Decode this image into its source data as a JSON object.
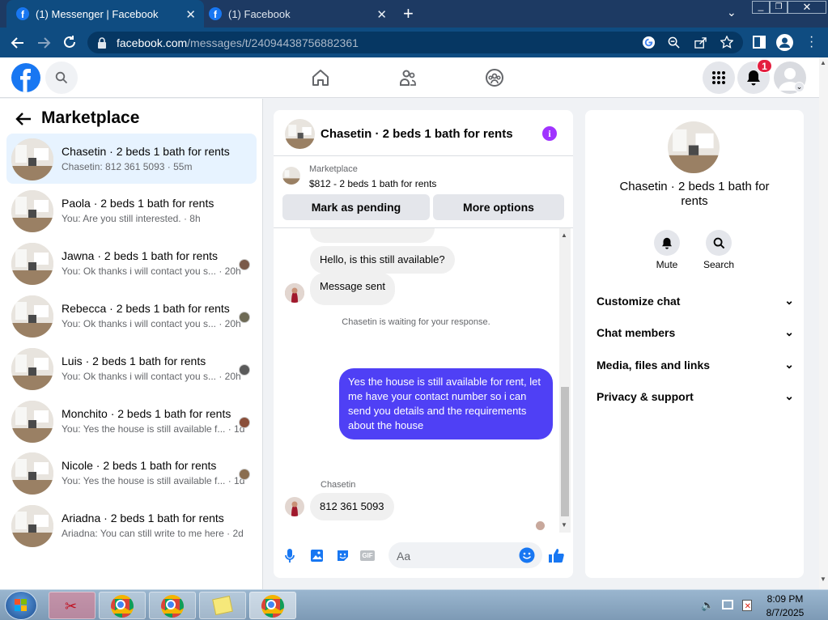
{
  "browser": {
    "tabs": [
      {
        "title": "(1) Messenger | Facebook"
      },
      {
        "title": "(1) Facebook"
      }
    ],
    "url_host": "facebook.com",
    "url_path": "/messages/t/24094438756882361"
  },
  "header": {
    "notification_count": "1"
  },
  "sidebar": {
    "title": "Marketplace",
    "threads": [
      {
        "name": "Chasetin · 2 beds 1 bath for rents",
        "preview": "Chasetin: 812 361 5093 · 55m"
      },
      {
        "name": "Paola · 2 beds 1 bath for rents",
        "preview": "You: Are you still interested. · 8h"
      },
      {
        "name": "Jawna · 2 beds 1 bath for rents",
        "preview": "You: Ok thanks i will contact you s... · 20h"
      },
      {
        "name": "Rebecca · 2 beds 1 bath for rents",
        "preview": "You: Ok thanks i will contact you s... · 20h"
      },
      {
        "name": "Luis · 2 beds 1 bath for rents",
        "preview": "You: Ok thanks i will contact you s... · 20h"
      },
      {
        "name": "Monchito · 2 beds 1 bath for rents",
        "preview": "You: Yes the house is still available f... · 1d"
      },
      {
        "name": "Nicole · 2 beds 1 bath for rents",
        "preview": "You: Yes the house is still available f... · 1d"
      },
      {
        "name": "Ariadna · 2 beds 1 bath for rents",
        "preview": "Ariadna: You can still write to me here · 2d"
      }
    ]
  },
  "chat": {
    "title": "Chasetin · 2 beds 1 bath for rents",
    "listing_label": "Marketplace",
    "listing_price": "$812 - 2 beds 1 bath for rents",
    "mark_pending": "Mark as pending",
    "more_options": "More options",
    "messages": {
      "q1": "Hello, is this still available?",
      "q2": "Message sent",
      "status": "Chasetin is waiting for your response.",
      "out": "Yes the house is still available for rent, let me have your contact number so i can send you details and the requirements about the house",
      "sender": "Chasetin",
      "in": "812 361 5093"
    },
    "composer_placeholder": "Aa"
  },
  "details": {
    "title": "Chasetin · 2 beds 1 bath for rents",
    "mute": "Mute",
    "search": "Search",
    "sections": [
      "Customize chat",
      "Chat members",
      "Media, files and links",
      "Privacy & support"
    ]
  },
  "taskbar": {
    "time": "8:09 PM",
    "date": "8/7/2025"
  },
  "colors": {
    "fb_blue": "#1877f2",
    "outgoing_bubble": "#4f40f5",
    "notification_red": "#e41e3f"
  }
}
